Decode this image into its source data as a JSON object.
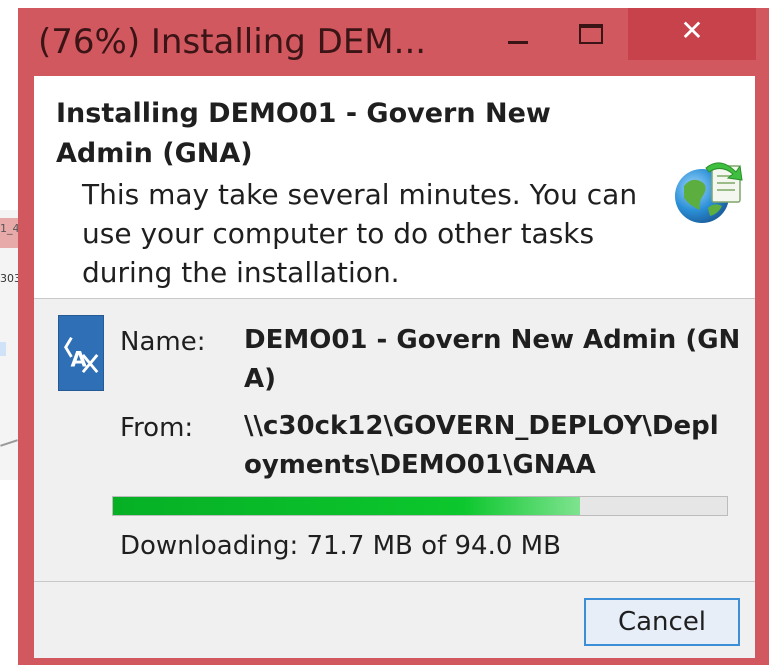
{
  "window": {
    "title": "(76%) Installing DEM...",
    "controls": {
      "minimize_icon": "minimize-icon",
      "maximize_icon": "maximize-icon",
      "close_glyph": "✕"
    }
  },
  "header": {
    "heading": "Installing DEMO01 - Govern New Admin (GNA)",
    "subtext": "This may take several minutes. You can use your computer to do other tasks during the installation.",
    "icon": "globe-install-icon"
  },
  "details": {
    "app_icon": "application-icon",
    "name_label": "Name:",
    "name_value": "DEMO01 - Govern New Admin (GNA)",
    "from_label": "From:",
    "from_value": "\\\\c30ck12\\GOVERN_DEPLOY\\Deployments\\DEMO01\\GNAA",
    "progress_fraction": 0.76,
    "status": "Downloading: 71.7 MB of 94.0 MB"
  },
  "footer": {
    "cancel_label": "Cancel"
  },
  "background_window": {
    "fragment_1": "1_4",
    "fragment_2": "303"
  },
  "colors": {
    "titlebar": "#d1585f",
    "close_button": "#c7424a",
    "progress_fill": "#06b025",
    "button_border": "#3c8fd6"
  }
}
